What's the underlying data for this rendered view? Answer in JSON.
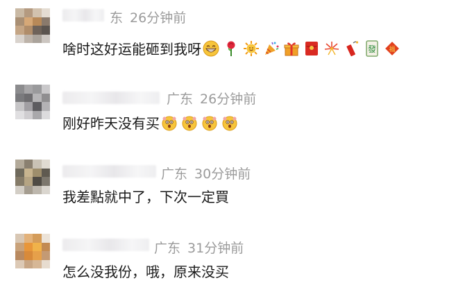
{
  "comments": [
    {
      "location": "东",
      "time": "26分钟前",
      "text": "啥时这好运能砸到我呀",
      "emojis": [
        "grin-icon",
        "rose-icon",
        "sun-icon",
        "party-popper-icon",
        "gift-icon",
        "red-envelope-icon",
        "fireworks-icon",
        "firecracker-icon",
        "mahjong-fa-icon",
        "fortune-diamond-icon"
      ]
    },
    {
      "location": "广东",
      "time": "26分钟前",
      "text": "刚好昨天没有买",
      "emojis": [
        "shocked-face-icon",
        "shocked-face-icon",
        "shocked-face-icon",
        "shocked-face-icon"
      ]
    },
    {
      "location": "广东",
      "time": "30分钟前",
      "text": "我差點就中了，下次一定買",
      "emojis": []
    },
    {
      "location": "广东",
      "time": "31分钟前",
      "text": "怎么没我份，哦，原来没买",
      "emojis": []
    }
  ],
  "colors": {
    "meta": "#9b9b9b",
    "text": "#1a1a1a"
  }
}
